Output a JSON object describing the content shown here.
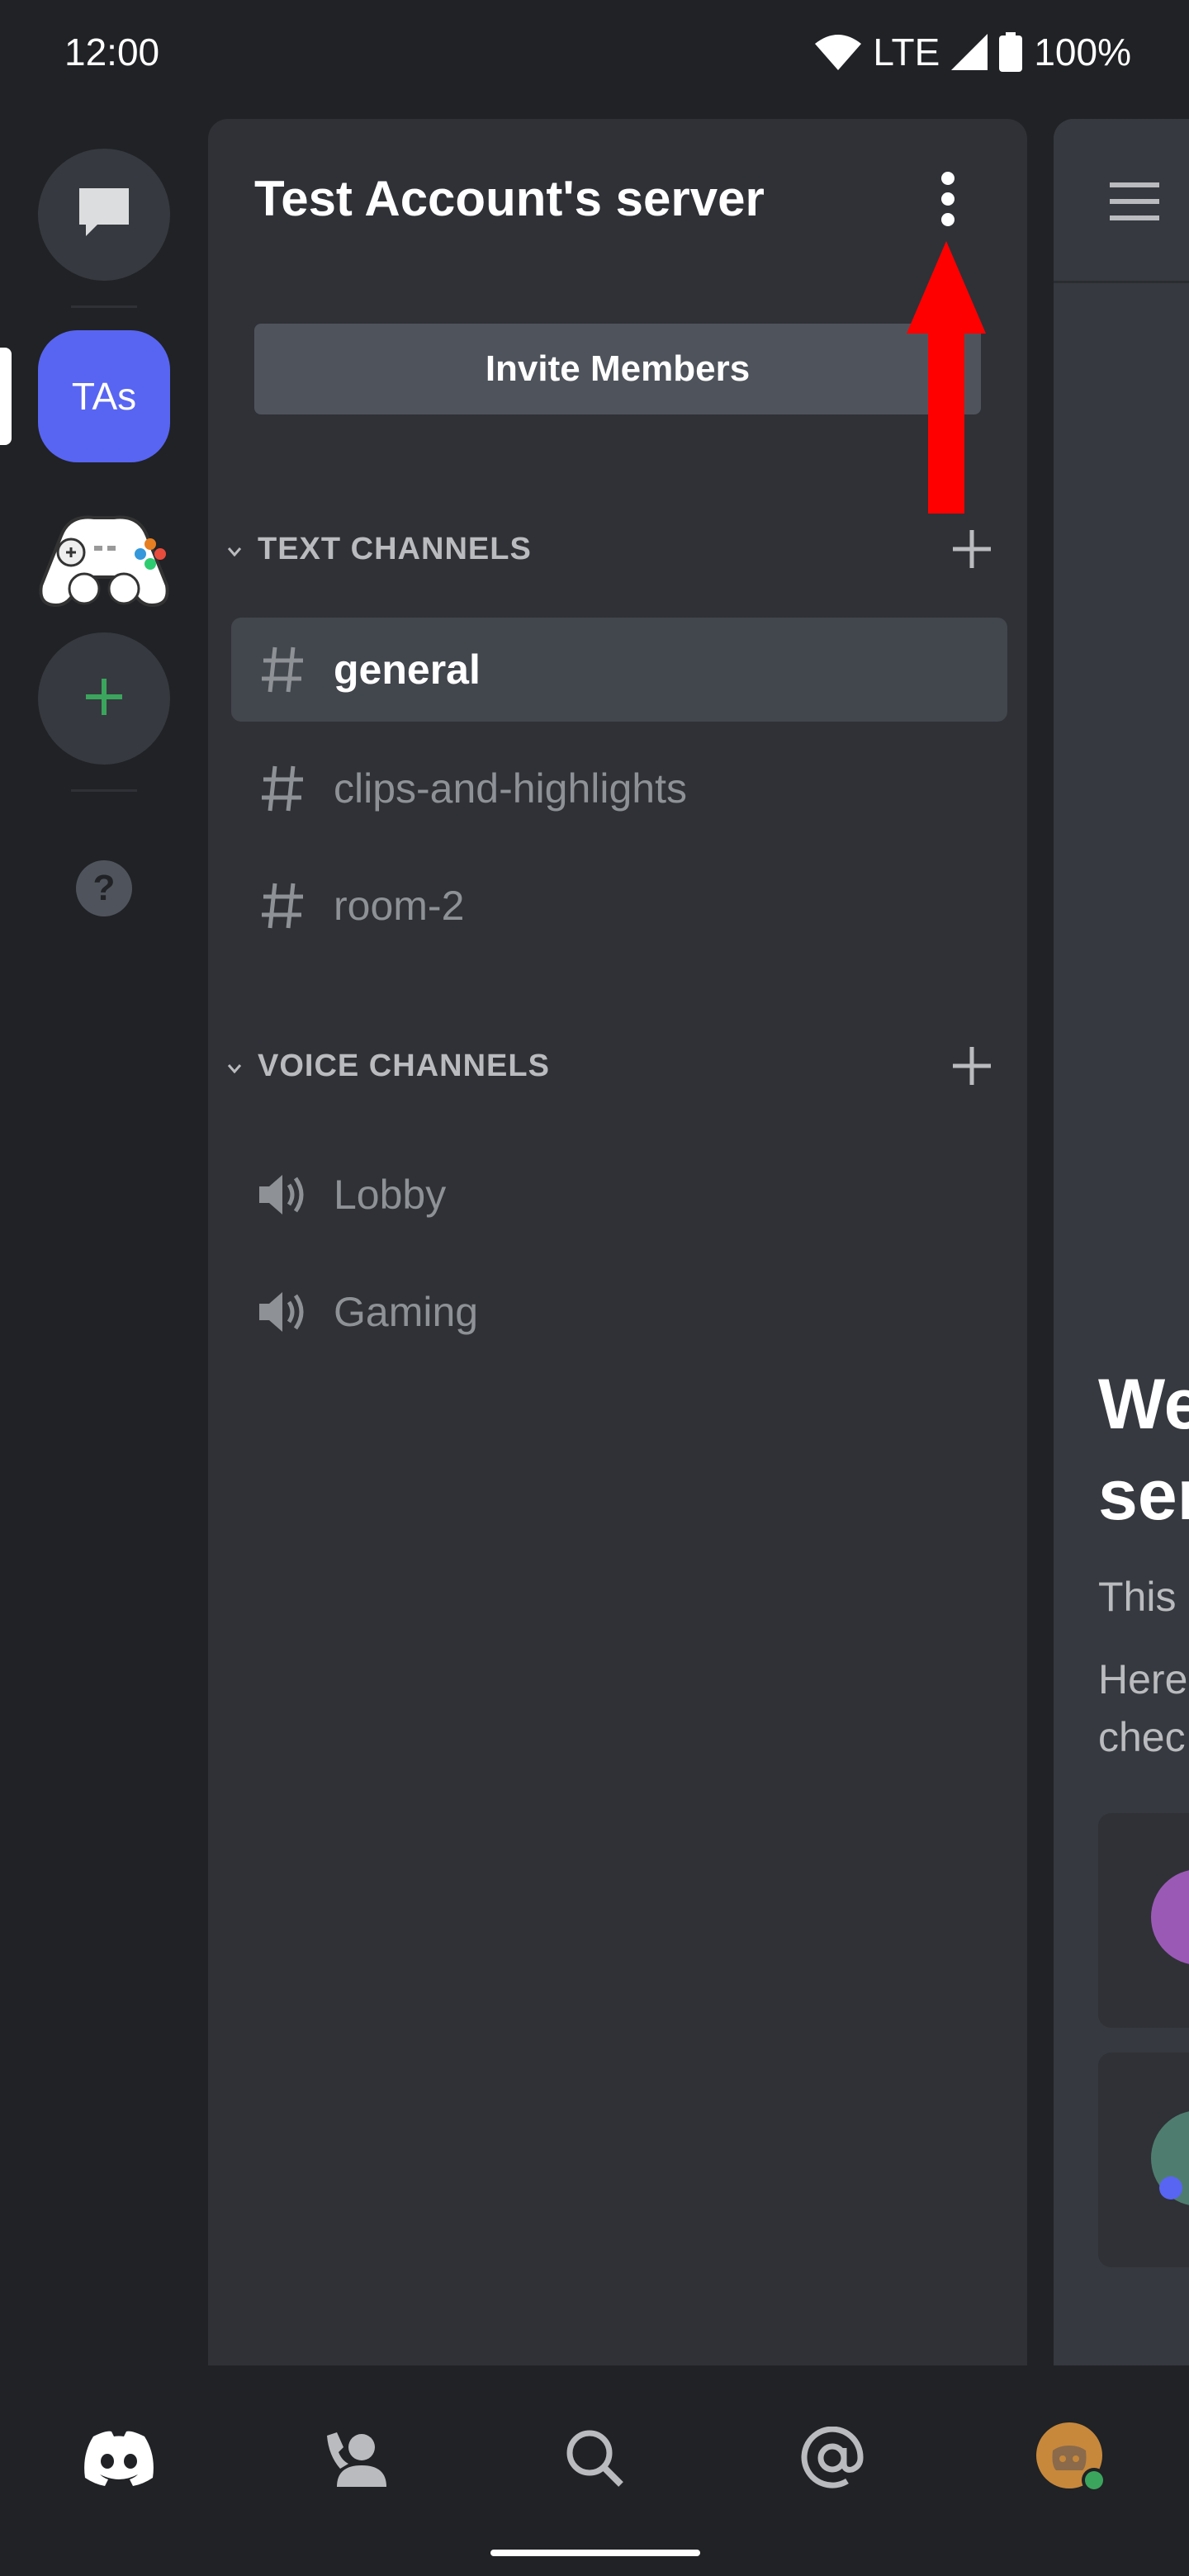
{
  "status_bar": {
    "time": "12:00",
    "network": "LTE",
    "battery": "100%"
  },
  "server_rail": {
    "items": [
      {
        "name": "direct-messages",
        "icon": "chat-bubble-icon"
      },
      {
        "name": "server-tas",
        "label": "TAs",
        "selected": true
      },
      {
        "name": "server-gamepad",
        "icon": "gamepad-icon"
      },
      {
        "name": "add-server",
        "icon": "plus-icon"
      },
      {
        "name": "help",
        "icon": "question-icon"
      }
    ]
  },
  "channel_panel": {
    "server_name": "Test Account's server",
    "invite_label": "Invite Members",
    "text_category": "TEXT CHANNELS",
    "voice_category": "VOICE CHANNELS",
    "text_channels": [
      {
        "name": "general",
        "active": true
      },
      {
        "name": "clips-and-highlights",
        "active": false
      },
      {
        "name": "room-2",
        "active": false
      }
    ],
    "voice_channels": [
      {
        "name": "Lobby"
      },
      {
        "name": "Gaming"
      }
    ]
  },
  "chat_preview": {
    "welcome_line1": "We",
    "welcome_line2": "ser",
    "desc_line1": "This",
    "desc_line2": "Here",
    "desc_line3": "chec"
  },
  "bottom_nav": [
    "home-icon",
    "friends-icon",
    "search-icon",
    "mentions-icon",
    "profile-avatar"
  ],
  "colors": {
    "accent": "#5865f2",
    "annotation_arrow": "#ff0000",
    "online": "#3ba55d"
  }
}
